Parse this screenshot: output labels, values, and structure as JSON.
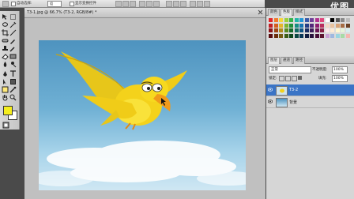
{
  "options_bar": {
    "auto_select_label": "自动选择:",
    "auto_select_value": "组",
    "show_transform_label": "显示变换控件"
  },
  "document": {
    "tab_title": "T3-1.jpg @ 66.7% (T3-2, RGB/8#) *"
  },
  "logo": {
    "text": "优图"
  },
  "swatches_panel": {
    "tabs": [
      "颜色",
      "色板",
      "样式"
    ],
    "active_tab": "色板",
    "colors": [
      "#e3262a",
      "#f0792b",
      "#f7d63a",
      "#9ccf3a",
      "#35b34a",
      "#1fb5a6",
      "#2196d6",
      "#3658a8",
      "#6f3f98",
      "#b0308e",
      "#e0457b",
      "#ffffff",
      "#000000",
      "#555555",
      "#888888",
      "#bbbbbb",
      "#c21f25",
      "#d45d1e",
      "#e5b52a",
      "#7cb52d",
      "#1f8f3a",
      "#168e83",
      "#1573b0",
      "#243f86",
      "#53297a",
      "#8d1e70",
      "#b82e5d",
      "#f2d6c4",
      "#e9c39e",
      "#d8a275",
      "#a66d44",
      "#6d4327",
      "#8c1418",
      "#9d4414",
      "#b18b1d",
      "#5a8a20",
      "#166b2b",
      "#106a62",
      "#0e5484",
      "#182d62",
      "#3c1c59",
      "#681552",
      "#8a1f45",
      "#fce7e8",
      "#fdebd5",
      "#fff8d0",
      "#e7f4d9",
      "#d7eef0",
      "#5a0d10",
      "#6a2d0c",
      "#775d12",
      "#3d5e15",
      "#0e481d",
      "#0a4742",
      "#093858",
      "#101e42",
      "#28123c",
      "#460e37",
      "#5c142e",
      "#c9a0d2",
      "#9fb8e0",
      "#9ad6e0",
      "#a7dba6",
      "#f5b7b1"
    ]
  },
  "layers_panel": {
    "tabs": [
      "图层",
      "通道",
      "路径"
    ],
    "active_tab": "图层",
    "blend_mode": "正常",
    "opacity_label": "不透明度:",
    "opacity_value": "100%",
    "lock_label": "锁定:",
    "fill_label": "填充:",
    "fill_value": "100%",
    "layers": [
      {
        "name": "T3-2",
        "selected": true
      },
      {
        "name": "背景",
        "selected": false
      }
    ]
  },
  "colors": {
    "foreground": "#f5ee1e",
    "background": "#ffffff",
    "selection": "#3a74c6"
  }
}
